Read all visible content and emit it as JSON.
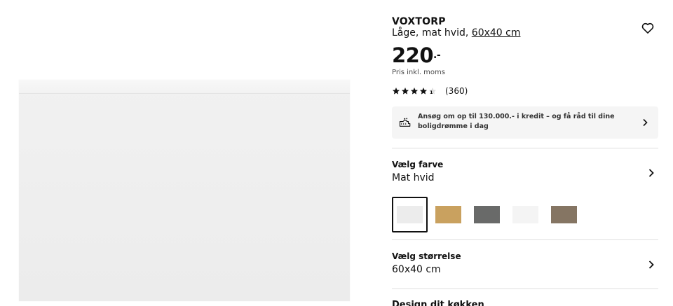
{
  "product": {
    "name": "VOXTORP",
    "description": "Låge, mat hvid, ",
    "size_link": "60x40 cm",
    "price": "220",
    "currency_suffix": ".-",
    "vat_note": "Pris inkl. moms",
    "rating": 4.5,
    "review_count": "(360)",
    "rating_mark": "1"
  },
  "credit_banner": {
    "text": "Ansøg om op til 130.000.- i kredit – og få råd til dine boligdrømme i dag"
  },
  "color_section": {
    "label": "Vælg farve",
    "value": "Mat hvid",
    "swatches": [
      {
        "name": "mat-hvid",
        "color": "#ececec",
        "selected": true
      },
      {
        "name": "eg",
        "color": "#c9a15f",
        "selected": false
      },
      {
        "name": "moerkegraa",
        "color": "#696a69",
        "selected": false
      },
      {
        "name": "hoejglans-hvid",
        "color": "#f4f4f4",
        "selected": false
      },
      {
        "name": "valnoed",
        "color": "#857563",
        "selected": false
      }
    ]
  },
  "size_section": {
    "label": "Vælg størrelse",
    "value": "60x40 cm"
  },
  "design_section": {
    "label": "Design dit køkken"
  },
  "colors": {
    "text": "#111111",
    "banner_bg": "#f5f5f5",
    "divider": "#dfdfdf"
  },
  "icons": [
    "heart-icon",
    "star-icon",
    "credit-icon",
    "chevron-right-icon"
  ]
}
